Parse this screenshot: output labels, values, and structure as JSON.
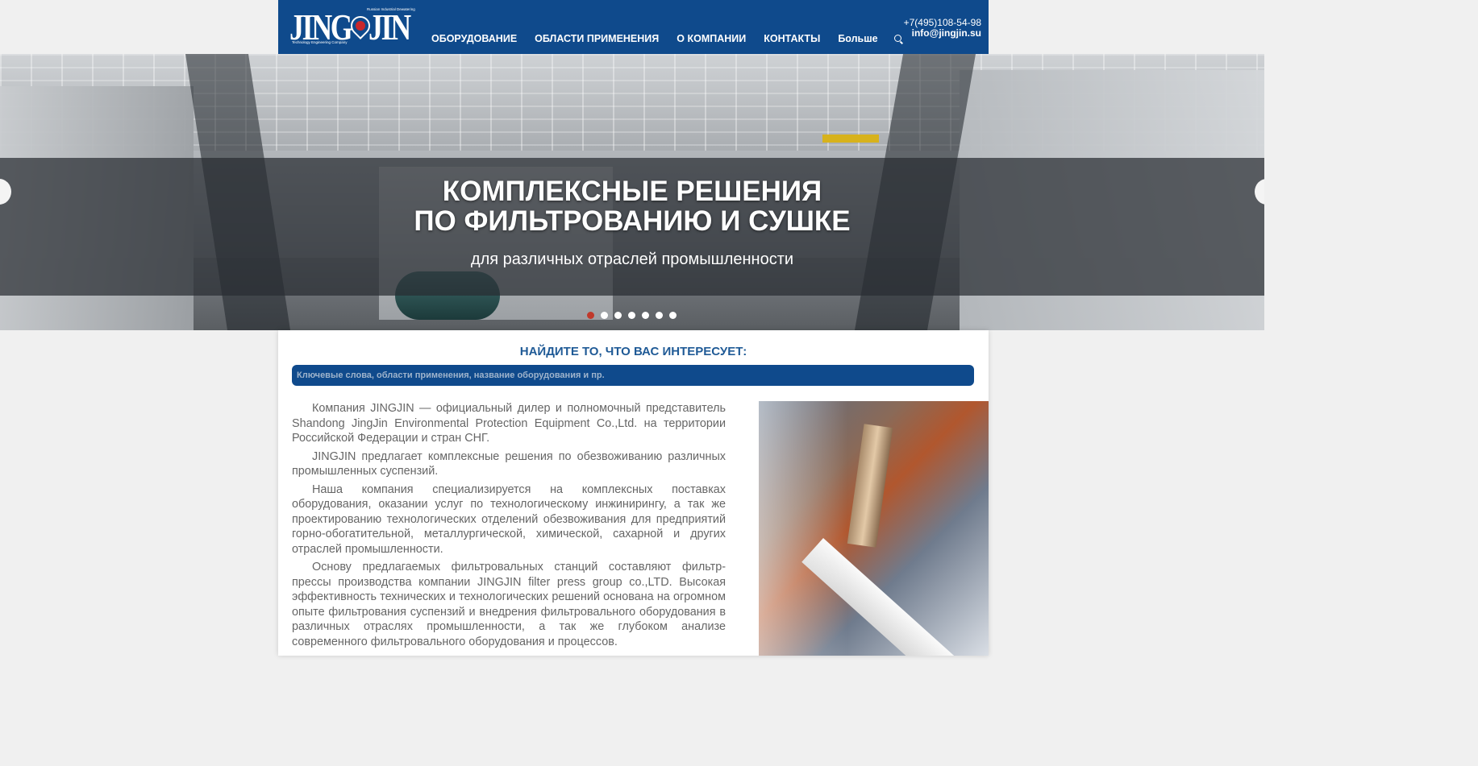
{
  "header": {
    "logo": {
      "left": "JING",
      "right": "JIN",
      "mark": "JJ",
      "tagline_top": "Russian Industrial Dewatering",
      "tagline_bottom": "Technology Engineering Company"
    },
    "nav": [
      {
        "label": "ОБОРУДОВАНИЕ"
      },
      {
        "label": "ОБЛАСТИ ПРИМЕНЕНИЯ"
      },
      {
        "label": "О КОМПАНИИ"
      },
      {
        "label": "КОНТАКТЫ"
      },
      {
        "label": "Больше"
      }
    ],
    "search_icon": "search-icon",
    "phone": "+7(495)108-54-98",
    "email": "info@jingjin.su"
  },
  "hero": {
    "title_line1": "КОМПЛЕКСНЫЕ РЕШЕНИЯ",
    "title_line2": "ПО ФИЛЬТРОВАНИЮ И СУШКЕ",
    "subtitle": "для различных отраслей промышленности",
    "slides_count": 7,
    "active_slide": 1,
    "accent_color": "#c0392b"
  },
  "search": {
    "title": "НАЙДИТЕ ТО, ЧТО ВАС ИНТЕРЕСУЕТ:",
    "placeholder": "Ключевые слова, области применения, название оборудования и пр."
  },
  "content": {
    "paragraphs": [
      "Компания JINGJIN — официальный дилер и полномочный представитель Shandong JingJin Environmental Protection Equipment Co.,Ltd. на территории Российской Федерации и стран СНГ.",
      "JINGJIN предлагает комплексные решения по обезвоживанию различных промышленных суспензий.",
      "Наша компания специализируется на комплексных поставках оборудования, оказании услуг по технологическому инжинирингу, а так же проектированию технологических отделений обезвоживания для предприятий горно-обогатительной, металлургической, химической, сахарной и других отраслей промышленности.",
      "Основу предлагаемых фильтровальных станций составляют фильтр-прессы производства компании JINGJIN filter press group co.,LTD. Высокая эффективность технических и технологических решений основана на огромном опыте фильтрования суспензий и внедрения фильтровального оборудования в различных отраслях промышленности, а так же глубоком анализе современного фильтровального оборудования и процессов."
    ]
  },
  "colors": {
    "brand_blue": "#0f4a8c",
    "title_blue": "#1f5a96",
    "page_bg": "#f0f0f0"
  }
}
